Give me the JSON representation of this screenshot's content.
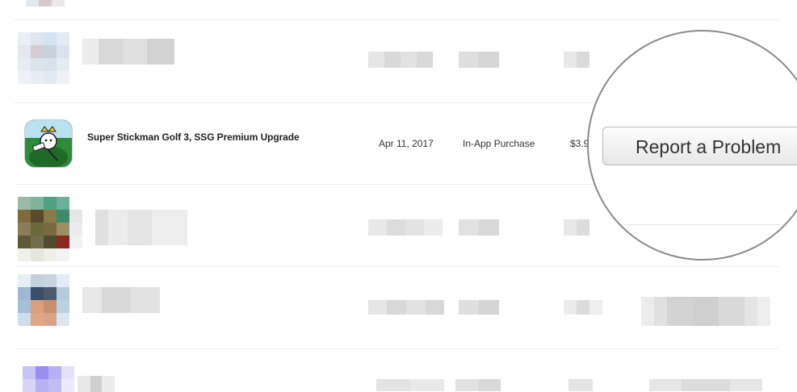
{
  "purchase": {
    "name": "Super Stickman Golf 3, SSG Premium Upgrade",
    "date": "Apr 11, 2017",
    "type": "In-App Purchase",
    "price": "$3.9",
    "icon": "golf-game-app-icon"
  },
  "actions": {
    "report_label": "Report a Problem"
  },
  "colors": {
    "separator": "#ececec",
    "lens_border": "#8a8a8a",
    "button_border": "#b9b9b9"
  }
}
